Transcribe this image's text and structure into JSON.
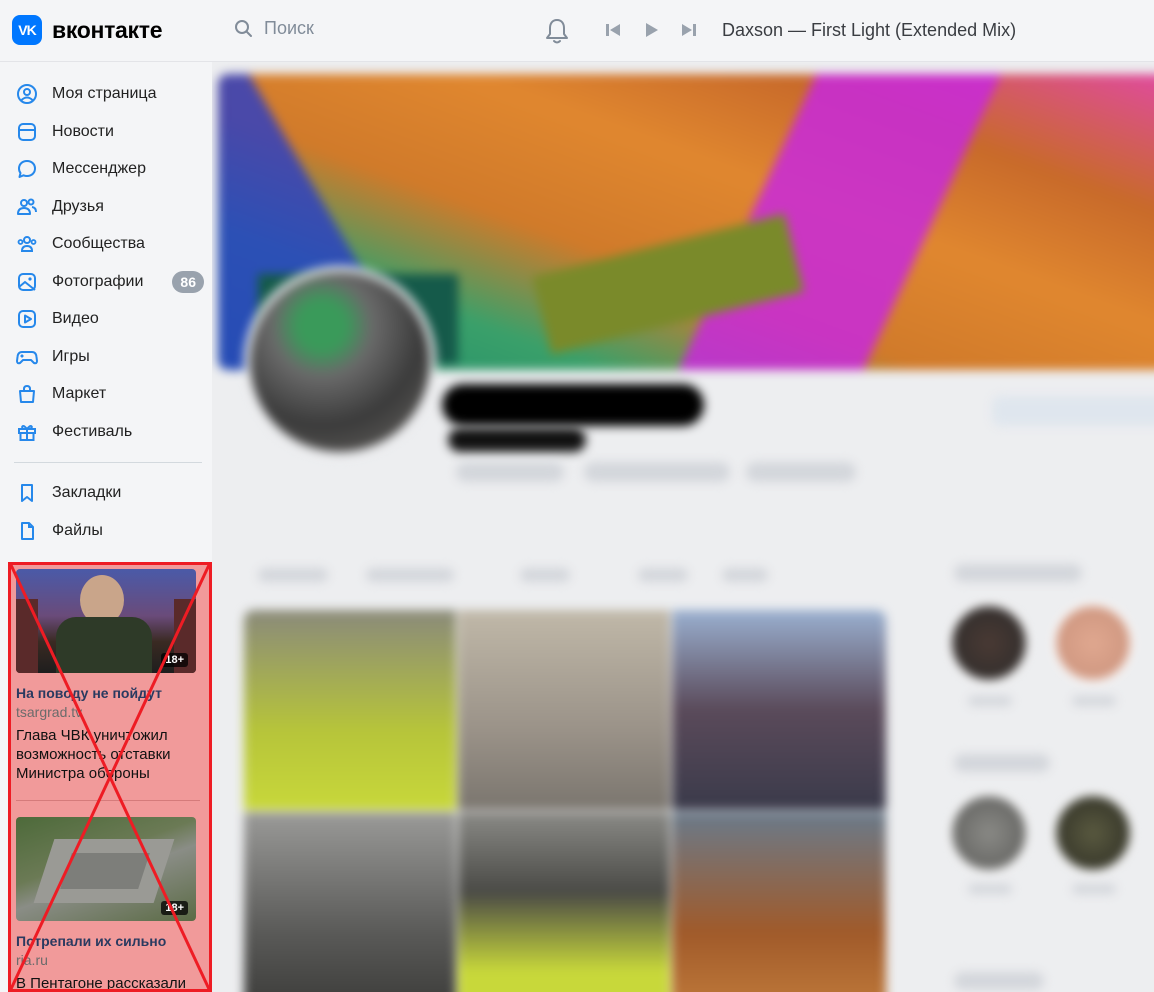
{
  "header": {
    "logo_text": "вконтакте",
    "search_placeholder": "Поиск",
    "now_playing": "Daxson — First Light (Extended Mix)"
  },
  "sidebar": {
    "items": [
      {
        "label": "Моя страница",
        "icon": "user-circle-icon"
      },
      {
        "label": "Новости",
        "icon": "newsfeed-icon"
      },
      {
        "label": "Мессенджер",
        "icon": "message-icon"
      },
      {
        "label": "Друзья",
        "icon": "friends-icon"
      },
      {
        "label": "Сообщества",
        "icon": "communities-icon"
      },
      {
        "label": "Фотографии",
        "icon": "photos-icon",
        "badge": "86"
      },
      {
        "label": "Видео",
        "icon": "video-icon"
      },
      {
        "label": "Игры",
        "icon": "gamepad-icon"
      },
      {
        "label": "Маркет",
        "icon": "market-bag-icon"
      },
      {
        "label": "Фестиваль",
        "icon": "gift-icon"
      }
    ],
    "secondary_items": [
      {
        "label": "Закладки",
        "icon": "bookmark-icon"
      },
      {
        "label": "Файлы",
        "icon": "file-icon"
      }
    ]
  },
  "ads": [
    {
      "age": "18+",
      "title": "На поводу не пойдут",
      "domain": "tsargrad.tv",
      "text": "Глава ЧВК уничтожил возможность отставки Министра обороны"
    },
    {
      "age": "18+",
      "title": "Потрепали их сильно",
      "domain": "ria.ru",
      "text": "В Пентагоне рассказали"
    }
  ],
  "colors": {
    "accent": "#0077ff",
    "ad_overlay": "#f19a9a",
    "ad_cross": "#ee1c24",
    "badge": "#99a2ad"
  }
}
